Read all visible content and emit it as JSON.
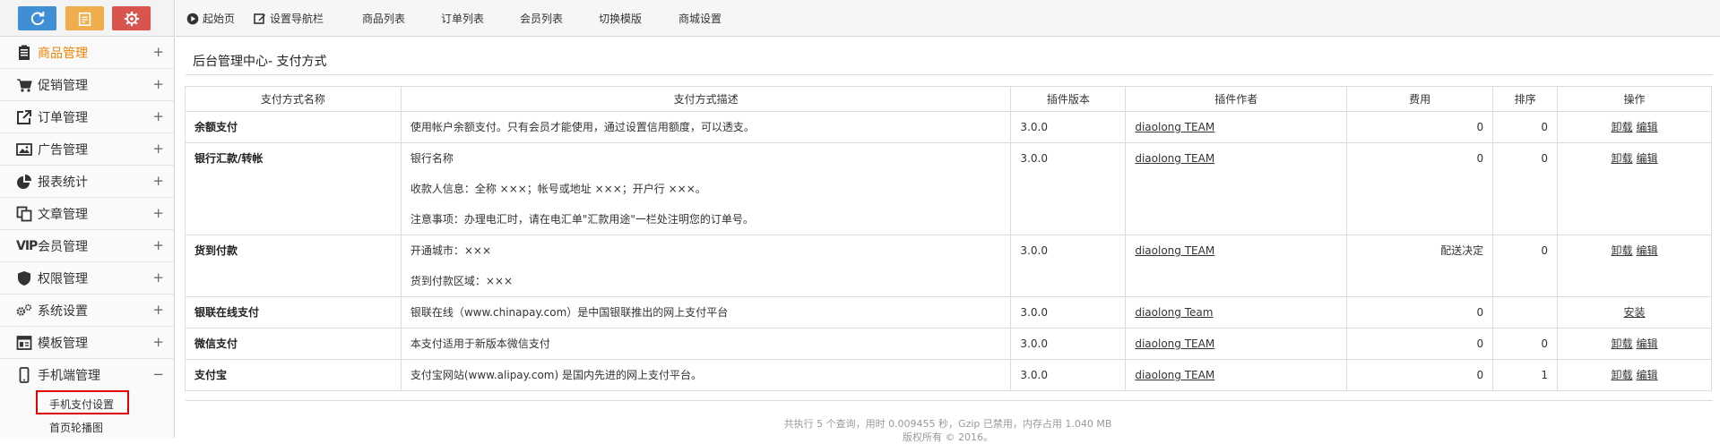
{
  "sidebar": {
    "top_buttons": [
      {
        "name": "refresh",
        "color": "#3e8fd5"
      },
      {
        "name": "notes",
        "color": "#f0ad4e"
      },
      {
        "name": "settings",
        "color": "#d9534f"
      }
    ],
    "menu": [
      {
        "label": "商品管理",
        "toggle": "+",
        "icon": "clipboard-icon"
      },
      {
        "label": "促销管理",
        "toggle": "+",
        "icon": "cart-icon"
      },
      {
        "label": "订单管理",
        "toggle": "+",
        "icon": "external-link-icon"
      },
      {
        "label": "广告管理",
        "toggle": "+",
        "icon": "image-icon"
      },
      {
        "label": "报表统计",
        "toggle": "+",
        "icon": "pie-chart-icon"
      },
      {
        "label": "文章管理",
        "toggle": "+",
        "icon": "copy-icon"
      },
      {
        "label": "会员管理",
        "toggle": "+",
        "icon": "vip-icon",
        "icon_text": "VIP"
      },
      {
        "label": "权限管理",
        "toggle": "+",
        "icon": "shield-icon"
      },
      {
        "label": "系统设置",
        "toggle": "+",
        "icon": "gears-icon"
      },
      {
        "label": "模板管理",
        "toggle": "+",
        "icon": "template-icon"
      },
      {
        "label": "手机端管理",
        "toggle": "−",
        "icon": "mobile-icon"
      }
    ],
    "submenu": [
      {
        "label": "手机支付设置"
      },
      {
        "label": "首页轮播图"
      }
    ]
  },
  "topnav": {
    "items": [
      {
        "label": "起始页",
        "icon": "play-circle-icon"
      },
      {
        "label": "设置导航栏",
        "icon": "edit-icon"
      },
      {
        "label": "商品列表"
      },
      {
        "label": "订单列表"
      },
      {
        "label": "会员列表"
      },
      {
        "label": "切换模版"
      },
      {
        "label": "商城设置"
      }
    ]
  },
  "breadcrumb": "后台管理中心- 支付方式",
  "table": {
    "headers": [
      "支付方式名称",
      "支付方式描述",
      "插件版本",
      "插件作者",
      "费用",
      "排序",
      "操作"
    ],
    "rows": [
      {
        "name": "余额支付",
        "desc": [
          "使用帐户余额支付。只有会员才能使用，通过设置信用额度，可以透支。"
        ],
        "version": "3.0.0",
        "author": "diaolong TEAM",
        "fee": "0",
        "order": "0",
        "ops": [
          "卸载",
          "编辑"
        ]
      },
      {
        "name": "银行汇款/转帐",
        "desc": [
          "银行名称",
          "收款人信息：全称 ×××；帐号或地址 ×××；开户行 ×××。",
          "注意事项：办理电汇时，请在电汇单\"汇款用途\"一栏处注明您的订单号。"
        ],
        "version": "3.0.0",
        "author": "diaolong TEAM",
        "fee": "0",
        "order": "0",
        "ops": [
          "卸载",
          "编辑"
        ]
      },
      {
        "name": "货到付款",
        "desc": [
          "开通城市：×××",
          "货到付款区域：×××"
        ],
        "version": "3.0.0",
        "author": "diaolong TEAM",
        "fee": "配送决定",
        "order": "0",
        "ops": [
          "卸载",
          "编辑"
        ]
      },
      {
        "name": "银联在线支付",
        "desc": [
          "银联在线（www.chinapay.com）是中国银联推出的网上支付平台"
        ],
        "version": "3.0.0",
        "author": "diaolong Team",
        "fee": "0",
        "order": "",
        "ops": [
          "安装"
        ]
      },
      {
        "name": "微信支付",
        "desc": [
          "本支付适用于新版本微信支付"
        ],
        "version": "3.0.0",
        "author": "diaolong TEAM",
        "fee": "0",
        "order": "0",
        "ops": [
          "卸载",
          "编辑"
        ]
      },
      {
        "name": "支付宝",
        "desc": [
          "支付宝网站(www.alipay.com) 是国内先进的网上支付平台。"
        ],
        "version": "3.0.0",
        "author": "diaolong TEAM",
        "fee": "0",
        "order": "1",
        "ops": [
          "卸载",
          "编辑"
        ]
      }
    ]
  },
  "footer": {
    "line1": "共执行 5 个查询，用时 0.009455 秒，Gzip 已禁用，内存占用 1.040 MB",
    "line2": "版权所有 © 2016。"
  },
  "colors": {
    "active_menu": "#f08300",
    "highlight_box": "#e00000"
  }
}
